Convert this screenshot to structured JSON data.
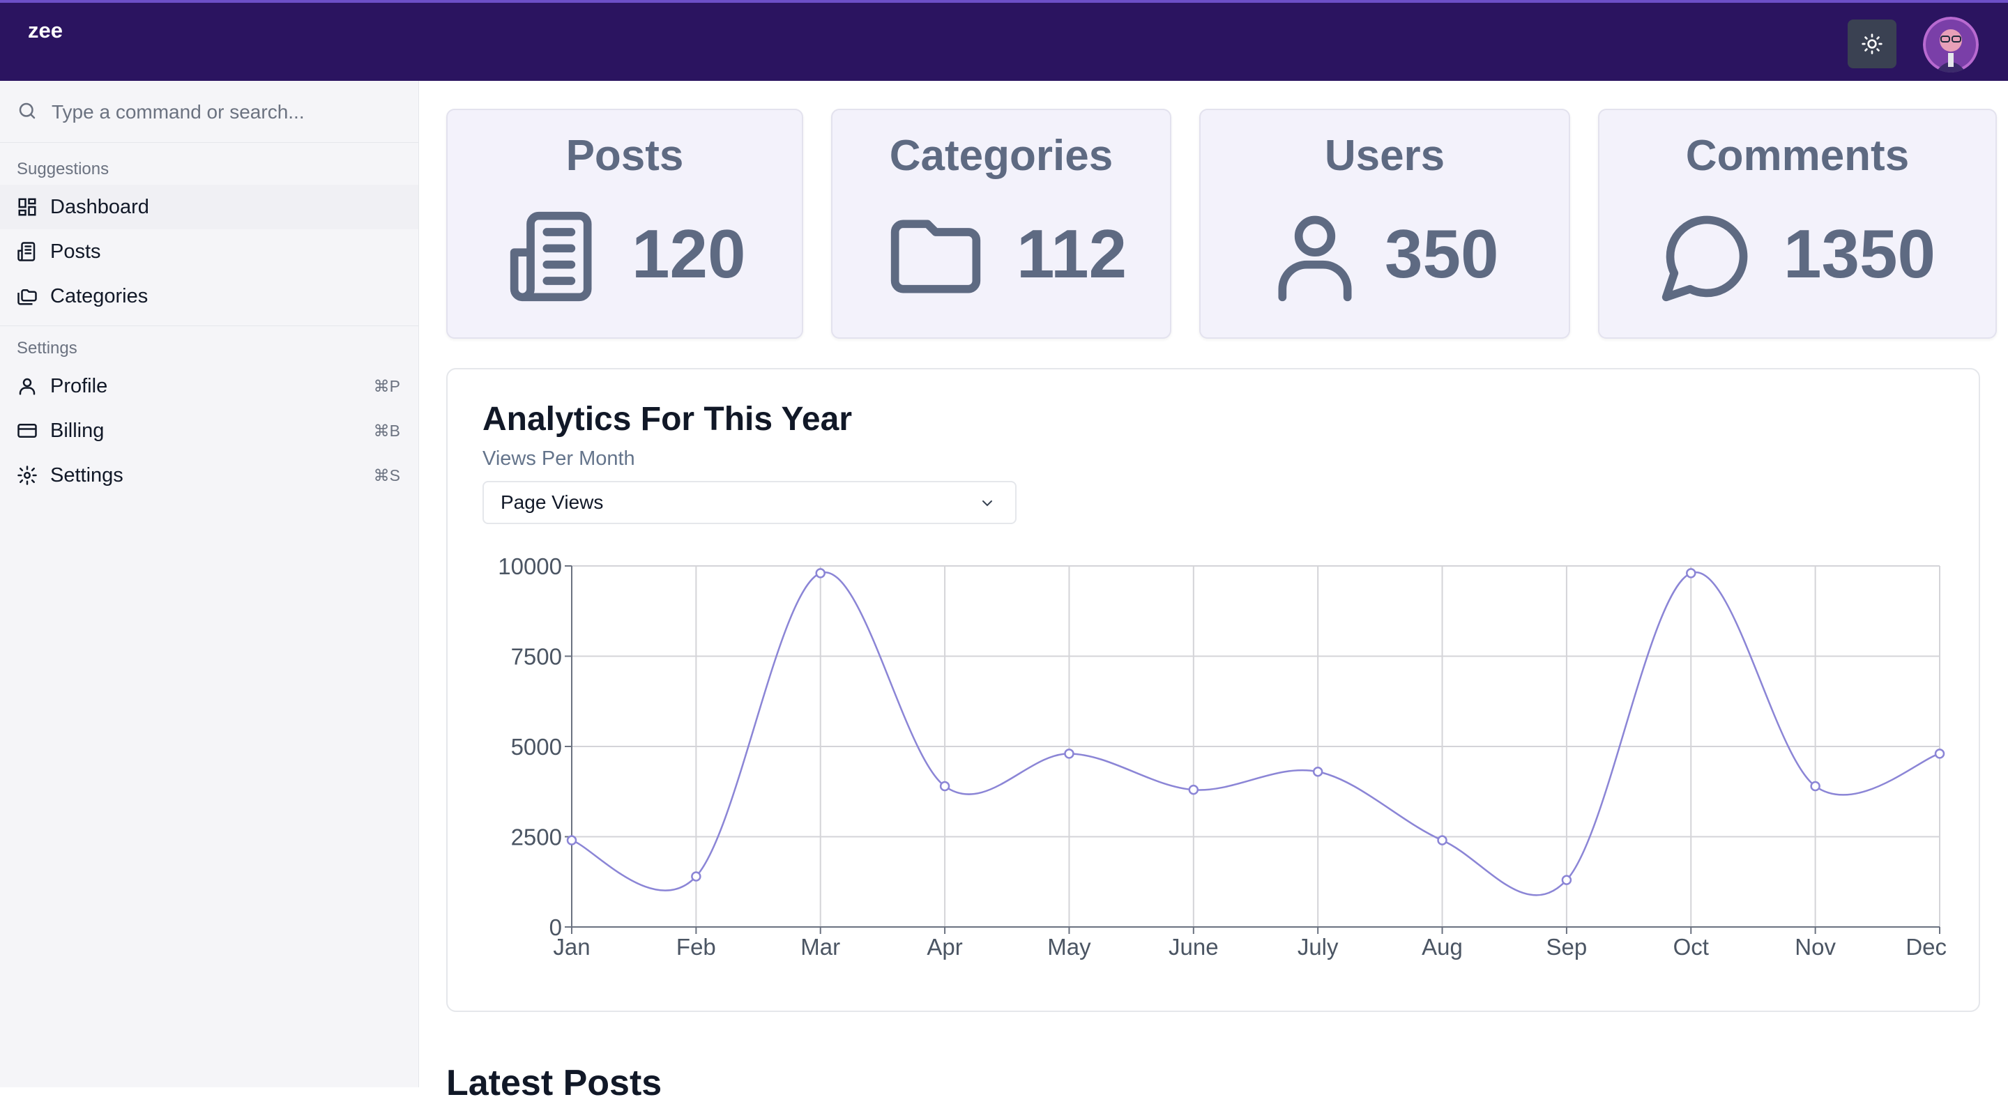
{
  "header": {
    "brand": "zee"
  },
  "sidebar": {
    "search_placeholder": "Type a command or search...",
    "suggestions_title": "Suggestions",
    "suggestions": [
      {
        "label": "Dashboard",
        "icon": "dashboard-icon"
      },
      {
        "label": "Posts",
        "icon": "newspaper-icon"
      },
      {
        "label": "Categories",
        "icon": "folders-icon"
      }
    ],
    "settings_title": "Settings",
    "settings": [
      {
        "label": "Profile",
        "icon": "user-icon",
        "shortcut": "⌘P"
      },
      {
        "label": "Billing",
        "icon": "credit-card-icon",
        "shortcut": "⌘B"
      },
      {
        "label": "Settings",
        "icon": "gear-icon",
        "shortcut": "⌘S"
      }
    ]
  },
  "stats": [
    {
      "title": "Posts",
      "value": "120",
      "icon": "newspaper-icon"
    },
    {
      "title": "Categories",
      "value": "112",
      "icon": "folder-icon"
    },
    {
      "title": "Users",
      "value": "350",
      "icon": "user-icon"
    },
    {
      "title": "Comments",
      "value": "1350",
      "icon": "message-circle-icon"
    }
  ],
  "analytics": {
    "title": "Analytics For This Year",
    "subtitle": "Views Per Month",
    "select_value": "Page Views"
  },
  "chart_data": {
    "type": "line",
    "categories": [
      "Jan",
      "Feb",
      "Mar",
      "Apr",
      "May",
      "June",
      "July",
      "Aug",
      "Sep",
      "Oct",
      "Nov",
      "Dec"
    ],
    "values": [
      2400,
      1400,
      9800,
      3900,
      4800,
      3800,
      4300,
      2400,
      1300,
      9800,
      3900,
      4800
    ],
    "ylim": [
      0,
      10000
    ],
    "yticks": [
      0,
      2500,
      5000,
      7500,
      10000
    ],
    "grid": true,
    "color": "#8b85d6"
  },
  "latest_posts": {
    "title": "Latest Posts"
  },
  "colors": {
    "topbar": "#2b1460",
    "card_bg": "#f3f2fb",
    "stat_text": "#5e6a82"
  }
}
